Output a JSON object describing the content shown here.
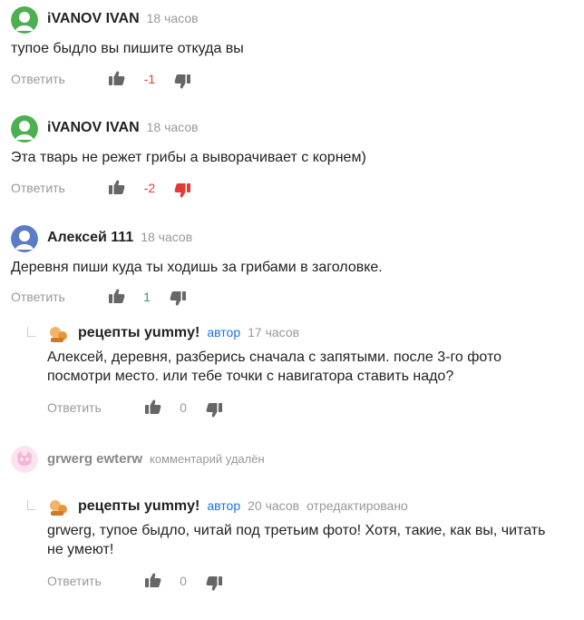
{
  "reply_label": "Ответить",
  "comments": [
    {
      "author": "iVANOV IVAN",
      "time": "18 часов",
      "text": "тупое быдло вы пишите откуда вы",
      "score": "-1",
      "score_color": "#e53935",
      "avatar_color": "#4caf50"
    },
    {
      "author": "iVANOV IVAN",
      "time": "18 часов",
      "text": "Эта тварь не режет грибы а выворачивает с корнем)",
      "score": "-2",
      "score_color": "#e53935",
      "avatar_color": "#4caf50",
      "disliked": true
    },
    {
      "author": "Алексей 111",
      "time": "18 часов",
      "text": "Деревня пиши куда ты ходишь за грибами в заголовке.",
      "score": "1",
      "score_color": "#2ea44f",
      "avatar_color": "#5c7cc6"
    }
  ],
  "reply1": {
    "author": "рецепты yummy!",
    "badge": "автор",
    "time": "17 часов",
    "text_line1": "Алексей, деревня, разберись сначала с запятыми. после 3-го фото",
    "text_line2": "посмотри место. или тебе точки с навигатора ставить надо?",
    "score": "0"
  },
  "deleted": {
    "author": "grwerg ewterw",
    "note": "комментарий удалён"
  },
  "reply2": {
    "author": "рецепты yummy!",
    "badge": "автор",
    "time": "20 часов",
    "edited": "отредактировано",
    "text_line1": "grwerg, тупое быдло, читай под третьим фото! Хотя, такие, как вы, читать",
    "text_line2": "не умеют!",
    "score": "0"
  }
}
